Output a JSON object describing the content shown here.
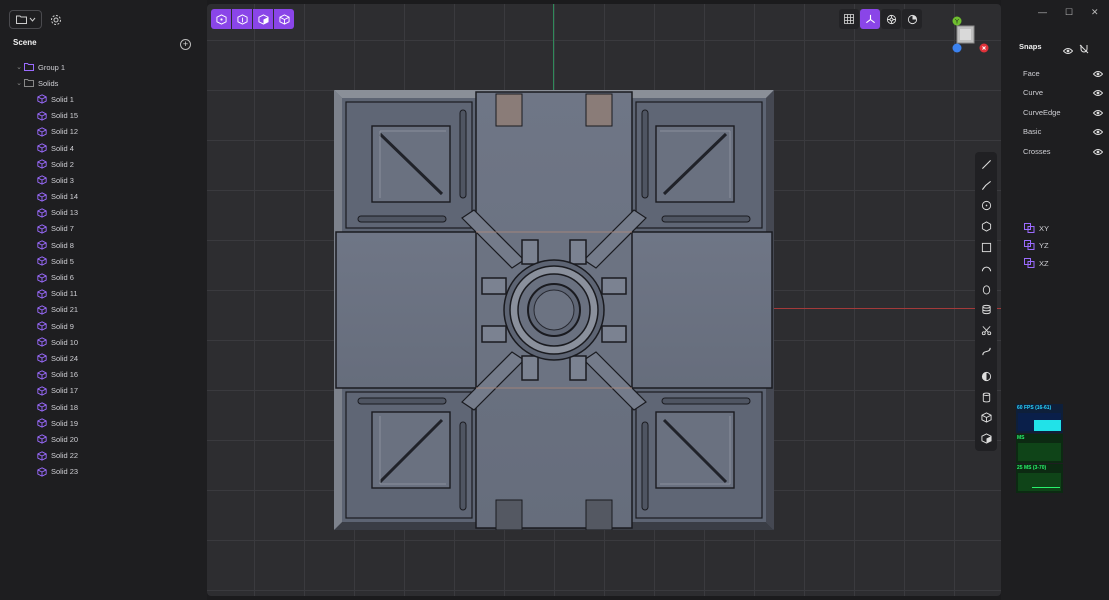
{
  "scene": {
    "title": "Scene",
    "group_label": "Group 1",
    "solids_label": "Solids",
    "solids": [
      "Solid 1",
      "Solid 15",
      "Solid 12",
      "Solid 4",
      "Solid 2",
      "Solid 3",
      "Solid 14",
      "Solid 13",
      "Solid 7",
      "Solid 8",
      "Solid 5",
      "Solid 6",
      "Solid 11",
      "Solid 21",
      "Solid 9",
      "Solid 10",
      "Solid 24",
      "Solid 16",
      "Solid 17",
      "Solid 18",
      "Solid 19",
      "Solid 20",
      "Solid 22",
      "Solid 23"
    ]
  },
  "snaps": {
    "title": "Snaps",
    "items": [
      "Face",
      "Curve",
      "CurveEdge",
      "Basic",
      "Crosses"
    ],
    "planes": [
      "XY",
      "YZ",
      "XZ"
    ]
  },
  "stats": {
    "fps_label": "60 FPS (16-61)",
    "ms_label": "MS",
    "mb_label": "25 MS (3-70)"
  },
  "gizmo": {
    "y_label": "Y"
  },
  "colors": {
    "accent": "#8a45e8",
    "icon_purple": "#9b6bff",
    "axis_red": "#a33a3a",
    "axis_green": "#2f8a5a"
  }
}
